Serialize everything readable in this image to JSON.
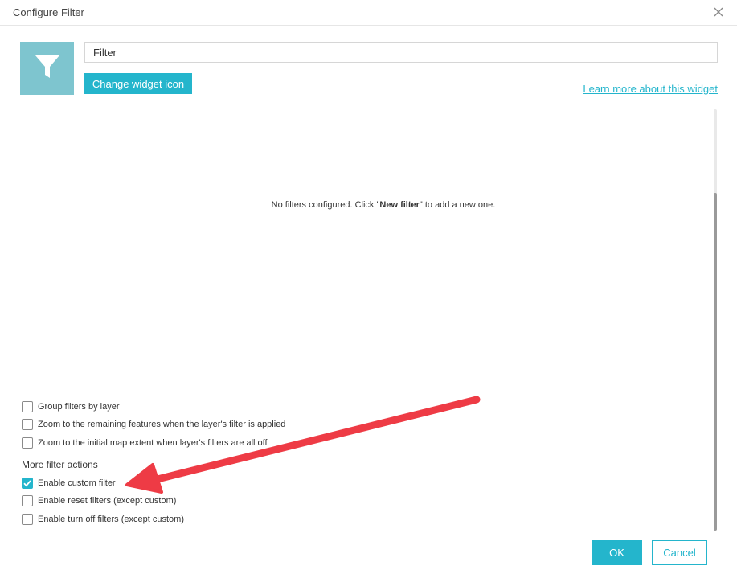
{
  "dialog": {
    "title": "Configure Filter",
    "close_icon": "close-icon"
  },
  "widget": {
    "icon": "filter-funnel-icon",
    "icon_bg_color": "#7ec5cf",
    "name_value": "Filter",
    "change_icon_label": "Change widget icon",
    "learn_more_label": "Learn more about this widget"
  },
  "filters": {
    "empty_msg_prefix": "No filters configured. Click \"",
    "empty_msg_bold": "New filter",
    "empty_msg_suffix": "\" to add a new one."
  },
  "options": [
    {
      "label": "Group filters by layer",
      "checked": false
    },
    {
      "label": "Zoom to the remaining features when the layer's filter is applied",
      "checked": false
    },
    {
      "label": "Zoom to the initial map extent when layer's filters are all off",
      "checked": false
    }
  ],
  "more_actions": {
    "title": "More filter actions",
    "items": [
      {
        "label": "Enable custom filter",
        "checked": true
      },
      {
        "label": "Enable reset filters (except custom)",
        "checked": false
      },
      {
        "label": "Enable turn off filters (except custom)",
        "checked": false
      }
    ]
  },
  "footer": {
    "ok_label": "OK",
    "cancel_label": "Cancel"
  },
  "colors": {
    "accent": "#24b5cc",
    "annotation_arrow": "#ee3b45"
  }
}
